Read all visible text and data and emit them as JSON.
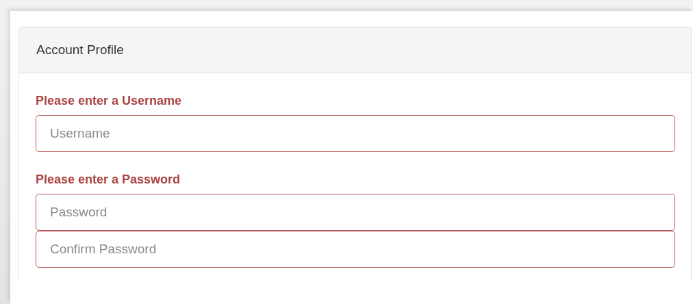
{
  "panel": {
    "title": "Account Profile"
  },
  "groups": [
    {
      "message": "Please enter a Username",
      "invalid": true,
      "fields": [
        {
          "placeholder": "Username"
        }
      ]
    },
    {
      "message": "Please enter a Password",
      "invalid": true,
      "fields": [
        {
          "placeholder": "Password"
        },
        {
          "placeholder": "Confirm Password"
        }
      ]
    }
  ]
}
